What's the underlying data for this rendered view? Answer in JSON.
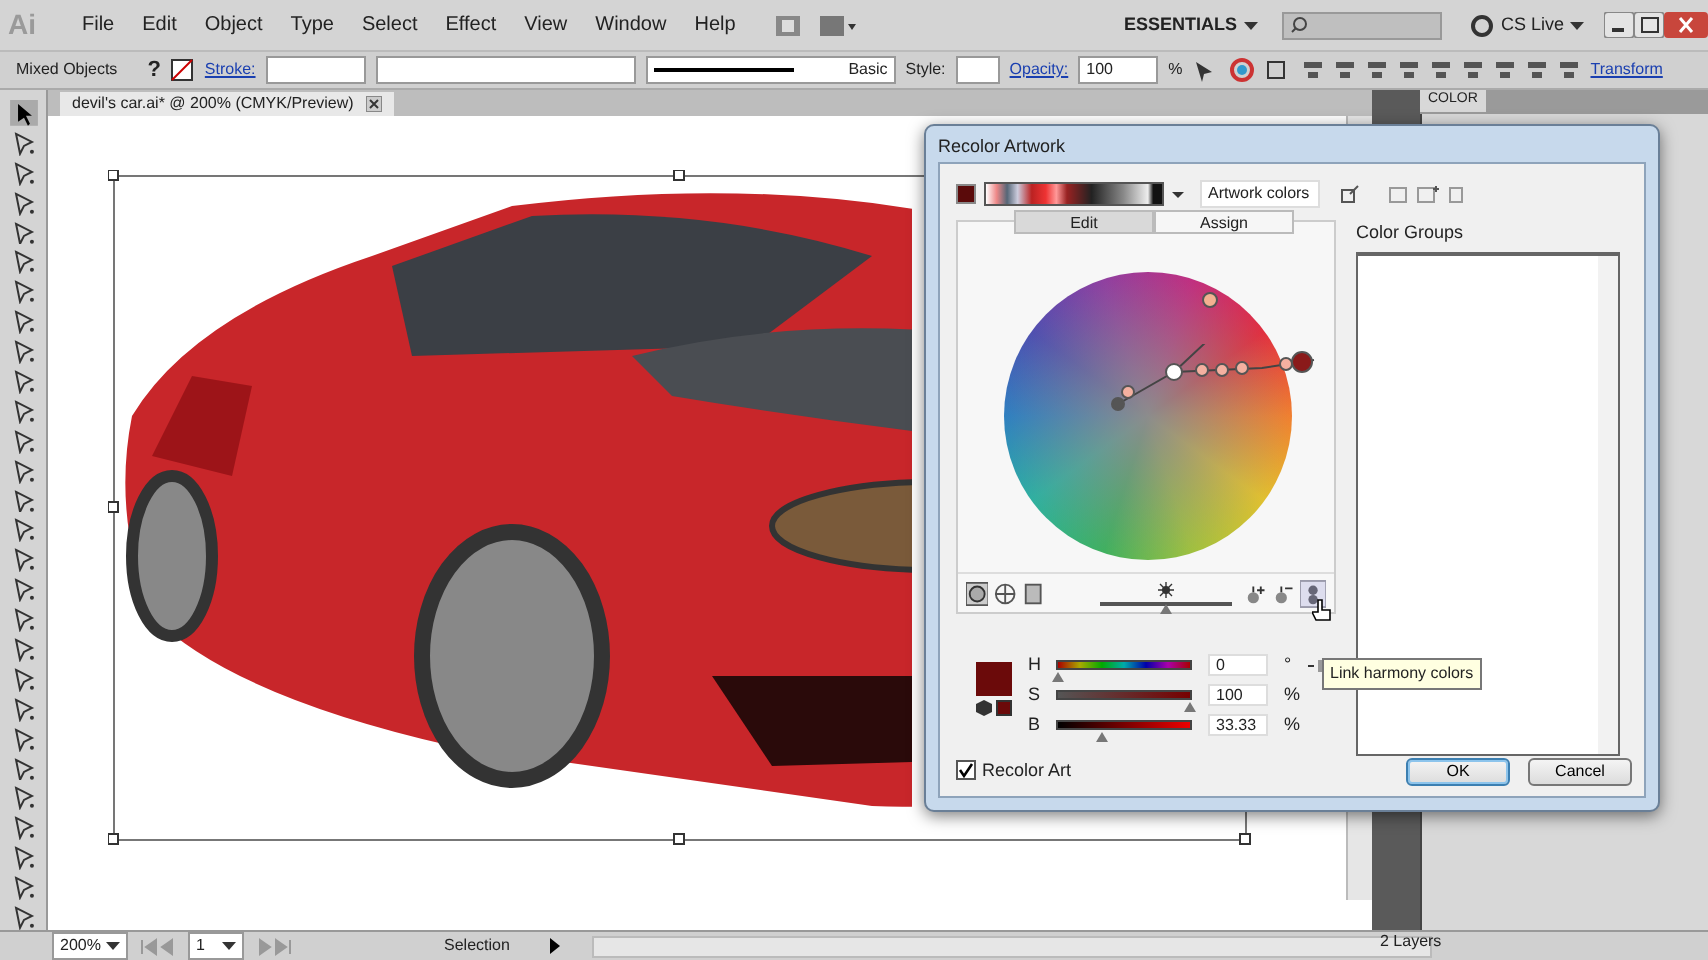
{
  "app": {
    "logo": "Ai"
  },
  "menu": [
    "File",
    "Edit",
    "Object",
    "Type",
    "Select",
    "Effect",
    "View",
    "Window",
    "Help"
  ],
  "workspace": "ESSENTIALS",
  "cs_live": "CS Live",
  "control_bar": {
    "selection": "Mixed Objects",
    "fill": "?",
    "stroke_label": "Stroke:",
    "stroke_profile": "Basic",
    "style_label": "Style:",
    "opacity_label": "Opacity:",
    "opacity": "100",
    "percent": "%",
    "transform": "Transform"
  },
  "document_tab": {
    "title": "devil's car.ai* @ 200% (CMYK/Preview)"
  },
  "panel_tabs": [
    {
      "label": "COLOR",
      "selected": true
    }
  ],
  "dialog": {
    "title": "Recolor Artwork",
    "preset": "Artwork colors",
    "tabs": [
      {
        "label": "Edit",
        "selected": true
      },
      {
        "label": "Assign",
        "selected": false
      }
    ],
    "color_groups_label": "Color Groups",
    "brightness_slider": {
      "level": 0.5
    },
    "hsb": [
      {
        "label": "H",
        "value": "0",
        "unit": "°",
        "level": 0.0
      },
      {
        "label": "S",
        "value": "100",
        "unit": "%",
        "level": 1.0
      },
      {
        "label": "B",
        "value": "33.33",
        "unit": "%",
        "level": 0.33
      }
    ],
    "tooltip": "Link harmony colors",
    "recolor_art": {
      "label": "Recolor Art",
      "checked": true
    },
    "buttons": [
      {
        "label": "OK",
        "kind": "default"
      },
      {
        "label": "Cancel",
        "kind": "normal"
      }
    ]
  },
  "status": {
    "zoom": "200%",
    "page": "1",
    "tool": "Selection"
  },
  "layers": {
    "count": "2 Layers"
  }
}
